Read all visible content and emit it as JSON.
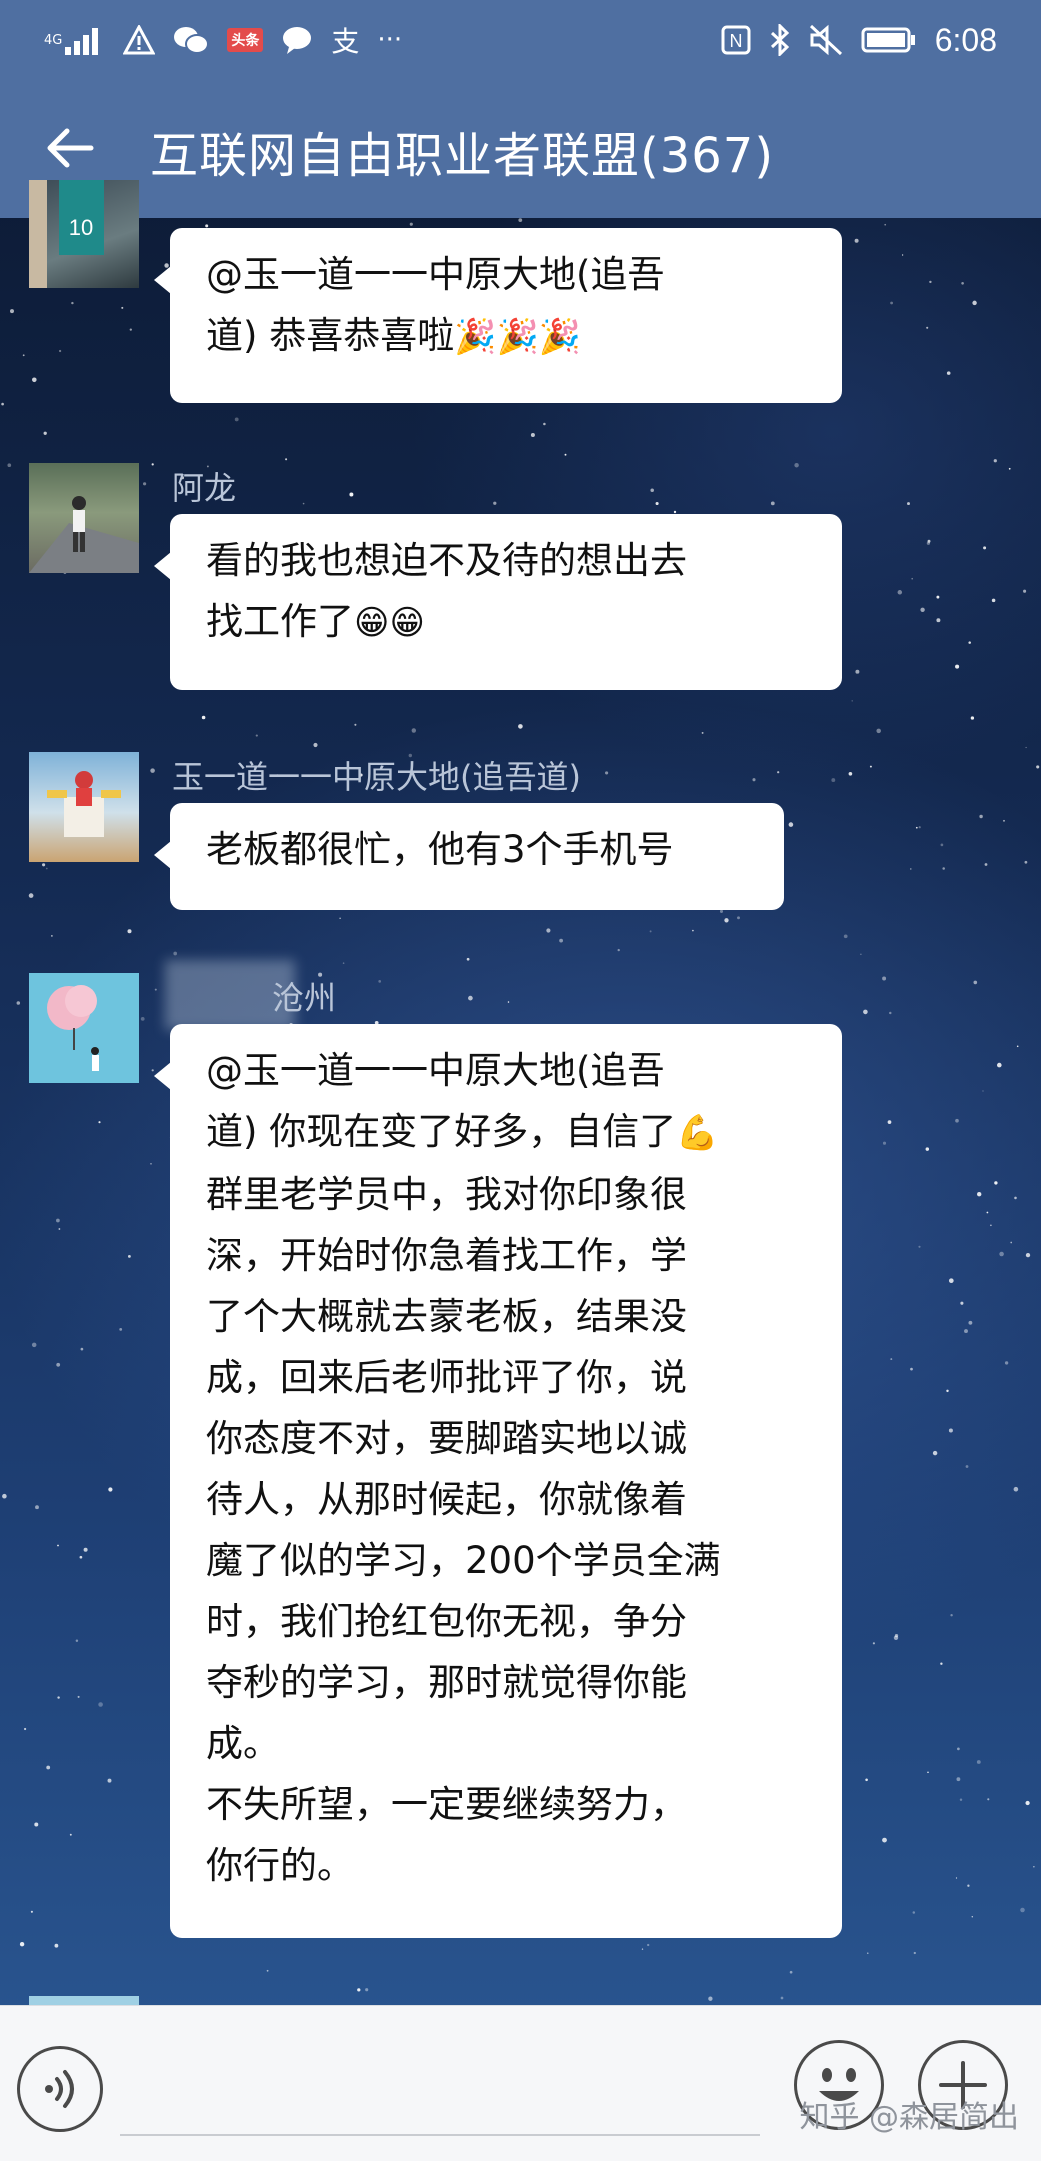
{
  "status_bar": {
    "network": "4G",
    "badge": "头条",
    "pay_icon": "支",
    "more": "···",
    "nfc": "N",
    "time": "6:08"
  },
  "header": {
    "title": "互联网自由职业者联盟(367)"
  },
  "messages": [
    {
      "sender": "",
      "text": "@玉一道一一中原大地(追吾\n道) 恭喜恭喜啦",
      "emoji": "🎉🎉🎉"
    },
    {
      "sender": "阿龙",
      "text": "看的我也想迫不及待的想出去\n找工作了",
      "emoji": "😁😁"
    },
    {
      "sender": "玉一道一一中原大地(追吾道)",
      "text": "老板都很忙，他有3个手机号",
      "emoji": ""
    },
    {
      "sender": "沧州",
      "text": "@玉一道一一中原大地(追吾\n道) 你现在变了好多，自信了",
      "emoji": "💪",
      "text2": "群里老学员中，我对你印象很\n深，开始时你急着找工作，学\n了个大概就去蒙老板，结果没\n成，回来后老师批评了你，说\n你态度不对，要脚踏实地以诚\n待人，从那时候起，你就像着\n魔了似的学习，200个学员全满\n时，我们抢红包你无视，争分\n夺秒的学习，那时就觉得你能\n成。\n不失所望，一定要继续努力，\n你行的。"
    }
  ],
  "input_bar": {
    "voice_icon": "voice-icon",
    "emoji_icon": "smiley-icon",
    "plus_icon": "plus-icon"
  },
  "watermark": "知乎 @森居简出"
}
